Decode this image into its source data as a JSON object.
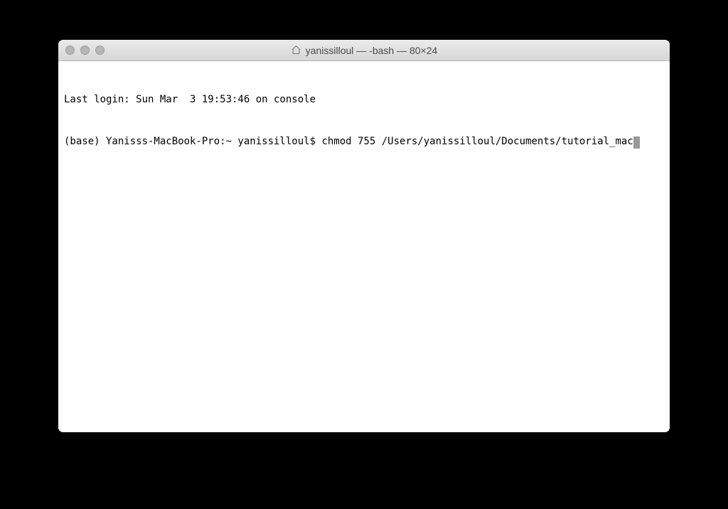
{
  "window": {
    "title": "yanissilloul — -bash — 80×24"
  },
  "terminal": {
    "line1": "Last login: Sun Mar  3 19:53:46 on console",
    "prompt": "(base) Yanisss-MacBook-Pro:~ yanissilloul$ ",
    "command": "chmod 755 /Users/yanissilloul/Documents/tutorial_mac"
  }
}
